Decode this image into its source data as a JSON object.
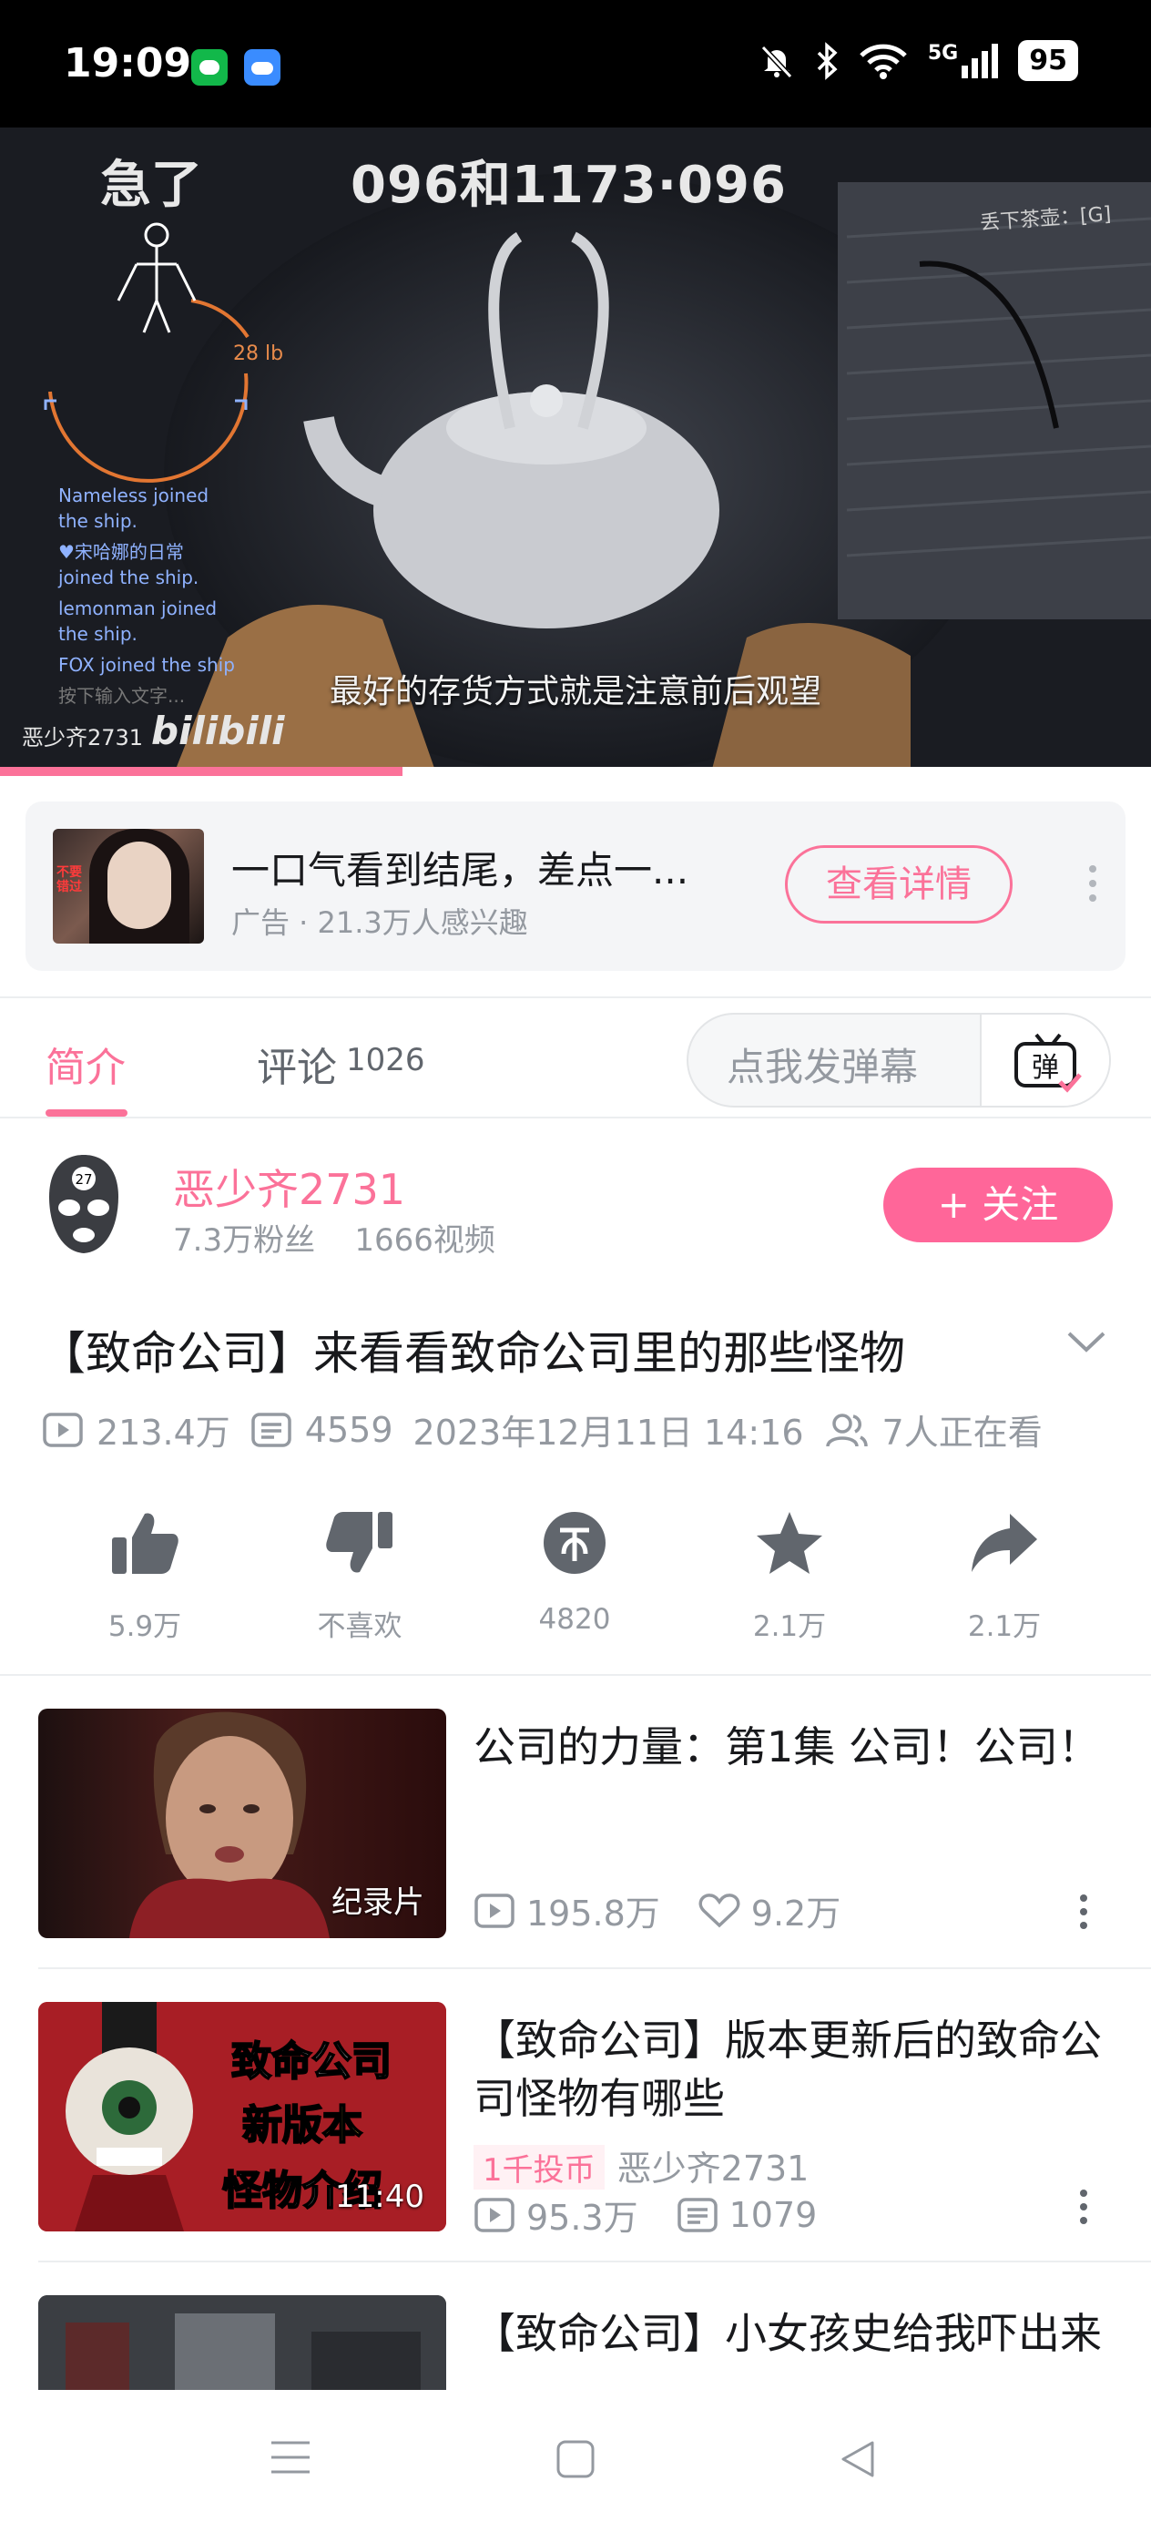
{
  "status_bar": {
    "time": "19:09",
    "network": "5G",
    "battery": "95",
    "icons": [
      "messaging-app-icon",
      "cloud-app-icon",
      "mute-bell-icon",
      "bluetooth-icon",
      "wifi-icon",
      "signal-icon",
      "battery-icon"
    ]
  },
  "video": {
    "hud_left": "急了",
    "hud_center": "096和1173·096",
    "hud_drop_hint": "丢下茶壶：[G]",
    "hud_weight": "28 lb",
    "hud_chat": [
      "Nameless joined the ship.",
      "♥宋哈娜的日常 joined the ship.",
      "lemonman joined the ship.",
      "FOX joined the ship",
      "按下输入文字..."
    ],
    "subtitle": "最好的存货方式就是注意前后观望",
    "watermark_user": "恶少齐2731",
    "watermark_logo": "bilibili",
    "progress": 0.35,
    "accent_color": "#fb7299"
  },
  "ad": {
    "title": "一口气看到结尾，差点一...",
    "subtitle": "广告 · 21.3万人感兴趣",
    "thumb_tag": "不要错过",
    "detail_button": "查看详情"
  },
  "tabs": {
    "intro": "简介",
    "comments": "评论",
    "comments_count": "1026",
    "danmaku_placeholder": "点我发弹幕",
    "danmaku_toggle": "弹"
  },
  "uploader": {
    "name": "恶少齐2731",
    "fans": "7.3万粉丝",
    "videos": "1666视频",
    "follow_button": "+ 关注",
    "avatar_badge": "27"
  },
  "video_info": {
    "title": "【致命公司】来看看致命公司里的那些怪物",
    "views": "213.4万",
    "danmaku": "4559",
    "date": "2023年12月11日 14:16",
    "watching": "7人正在看"
  },
  "actions": [
    {
      "name": "like",
      "label": "5.9万"
    },
    {
      "name": "dislike",
      "label": "不喜欢"
    },
    {
      "name": "coin",
      "label": "4820"
    },
    {
      "name": "favorite",
      "label": "2.1万"
    },
    {
      "name": "share",
      "label": "2.1万"
    }
  ],
  "recommendations": [
    {
      "title": "公司的力量：第1集 公司！公司！",
      "badge": "纪录片",
      "views": "195.8万",
      "likes": "9.2万"
    },
    {
      "title": "【致命公司】版本更新后的致命公司怪物有哪些",
      "badge": "11:40",
      "thumb_text": [
        "致命公司",
        "新版本",
        "怪物介绍"
      ],
      "coin_tag": "1千投币",
      "owner": "恶少齐2731",
      "views": "95.3万",
      "danmaku": "1079"
    },
    {
      "title": "【致命公司】小女孩史给我吓出来"
    }
  ]
}
